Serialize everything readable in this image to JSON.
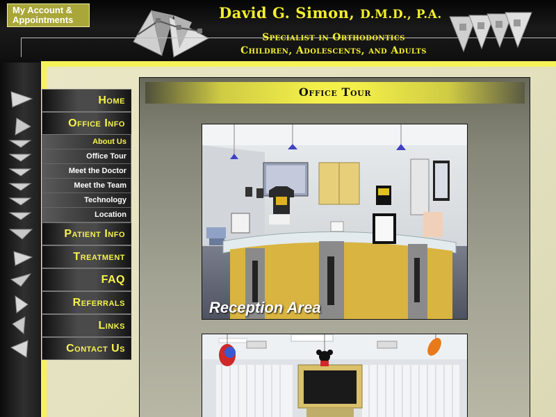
{
  "header": {
    "account_line1": "My Account &",
    "account_line2": "Appointments",
    "practice_name": "David G. Simon,",
    "practice_suffix": "D.M.D., P.A.",
    "specialty_line1": "Specialist in Orthodontics",
    "specialty_line2": "Children, Adolescents, and Adults"
  },
  "nav": {
    "home": "Home",
    "office_info": "Office Info",
    "sub_items": [
      "About Us",
      "Office Tour",
      "Meet the Doctor",
      "Meet the Team",
      "Technology",
      "Location"
    ],
    "patient_info": "Patient Info",
    "treatment": "Treatment",
    "faq": "FAQ",
    "referrals": "Referrals",
    "links": "Links",
    "contact_us": "Contact Us"
  },
  "content": {
    "title": "Office Tour",
    "photo1_caption": "Reception Area"
  },
  "colors": {
    "accent_yellow": "#f3f02a",
    "background_dark": "#1c1c1c",
    "frame_yellow": "#f6f35a"
  },
  "icons": [
    "triangle-logo-icon",
    "triangle-deco-icon"
  ]
}
